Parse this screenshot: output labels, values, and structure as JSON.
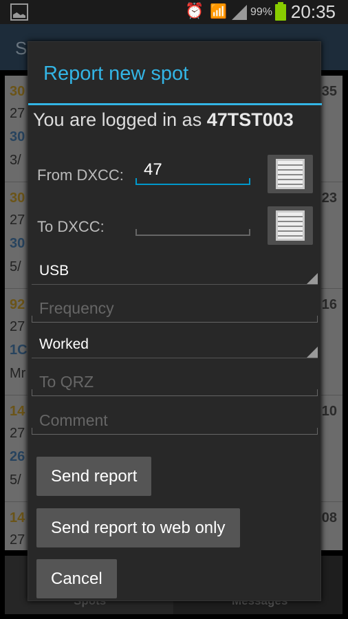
{
  "status_bar": {
    "battery": "99%",
    "time": "20:35",
    "icons": [
      "gallery-icon",
      "alarm-icon",
      "wifi-icon",
      "signal-icon",
      "battery-icon"
    ]
  },
  "action_bar": {
    "title_fragment": "S"
  },
  "background_list": {
    "rows": [
      {
        "a": "30",
        "b": "27",
        "c": "30",
        "d": "3/",
        "r": "35"
      },
      {
        "a": "30",
        "b": "27",
        "c": "30",
        "d": "5/",
        "r": "23"
      },
      {
        "a": "92",
        "b": "27",
        "c": "1C",
        "d": "Mr",
        "r": "16"
      },
      {
        "a": "14",
        "b": "27",
        "c": "26",
        "d": "5/",
        "r": "10"
      },
      {
        "a": "14",
        "b": "27",
        "c": "",
        "d": "",
        "r": "08"
      }
    ]
  },
  "tabs": [
    "Spots",
    "Messages"
  ],
  "dialog": {
    "title": "Report new spot",
    "login_prefix": "You are logged in as ",
    "login_user": "47TST003",
    "from_dxcc_label": "From DXCC:",
    "from_dxcc_value": "47",
    "to_dxcc_label": "To DXCC:",
    "to_dxcc_value": "",
    "mode": "USB",
    "frequency_placeholder": "Frequency",
    "status": "Worked",
    "to_qrz_placeholder": "To QRZ",
    "comment_placeholder": "Comment",
    "send_report": "Send report",
    "send_web_only": "Send report to web only",
    "cancel": "Cancel"
  },
  "colors": {
    "accent": "#33b5e5",
    "dialog_bg": "#282828"
  }
}
